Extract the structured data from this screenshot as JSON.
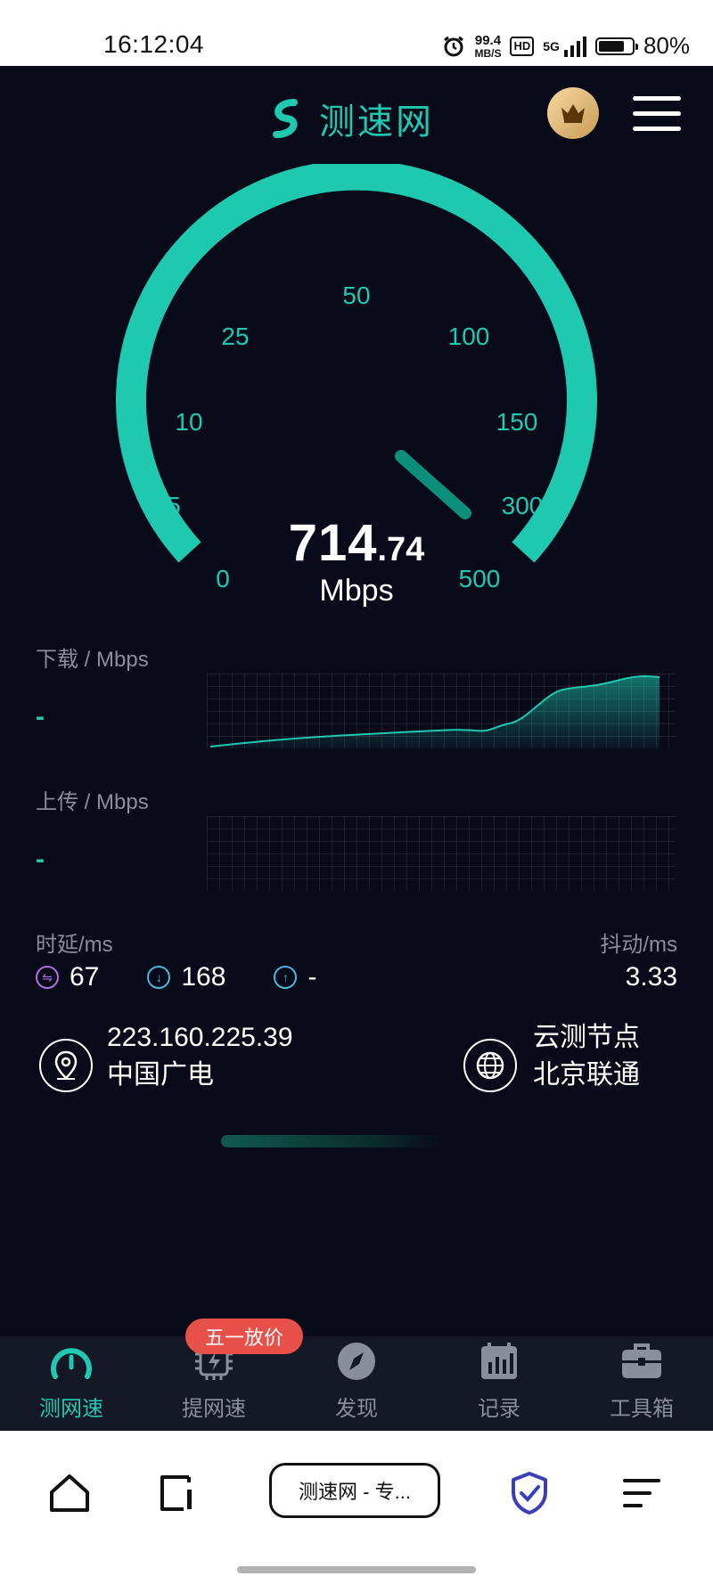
{
  "status": {
    "time": "16:12:04",
    "speed_value": "99.4",
    "speed_unit": "MB/S",
    "hd": "HD",
    "network": "5G",
    "battery_pct": "80%",
    "battery_fill": 0.8
  },
  "header": {
    "app_name": "测速网"
  },
  "gauge": {
    "ticks": [
      "0",
      "5",
      "10",
      "25",
      "50",
      "100",
      "150",
      "300",
      "500"
    ],
    "reading_int": "714",
    "reading_dec": ".74",
    "unit": "Mbps",
    "accent": "#1ec9b0"
  },
  "download": {
    "label": "下载 / Mbps",
    "value": "-"
  },
  "upload": {
    "label": "上传 / Mbps",
    "value": "-"
  },
  "latency": {
    "label": "时延/ms",
    "idle": "67",
    "down": "168",
    "up": "-"
  },
  "jitter": {
    "label": "抖动/ms",
    "value": "3.33"
  },
  "client": {
    "ip": "223.160.225.39",
    "isp": "中国广电"
  },
  "server": {
    "title": "云测节点",
    "name": "北京联通"
  },
  "tabs": [
    {
      "label": "测网速",
      "icon": "speedometer-icon"
    },
    {
      "label": "提网速",
      "icon": "chip-bolt-icon"
    },
    {
      "label": "发现",
      "icon": "compass-icon"
    },
    {
      "label": "记录",
      "icon": "record-chart-icon"
    },
    {
      "label": "工具箱",
      "icon": "toolbox-icon"
    }
  ],
  "promo_badge": "五一放价",
  "browser": {
    "tab_title": "测速网 - 专..."
  }
}
